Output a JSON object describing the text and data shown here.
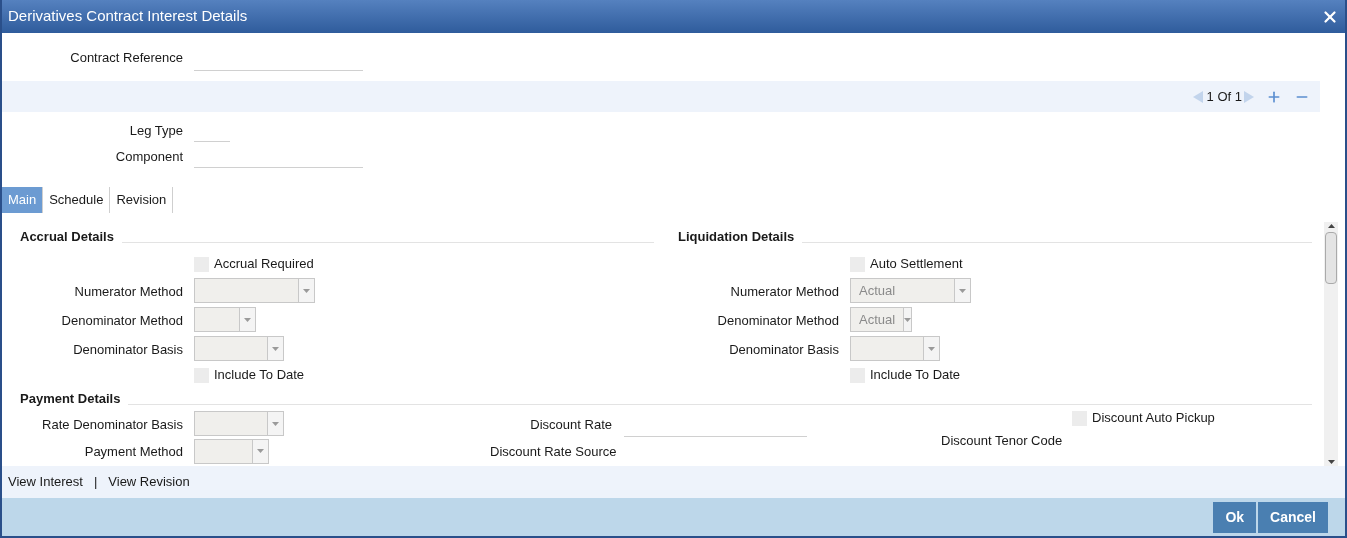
{
  "window": {
    "title": "Derivatives Contract Interest Details"
  },
  "contract_reference": {
    "label": "Contract Reference"
  },
  "pager": {
    "text": "1 Of 1"
  },
  "leg_fields": [
    {
      "label": "Leg Type",
      "kind": "short"
    },
    {
      "label": "Component",
      "kind": "long"
    }
  ],
  "tabs": [
    {
      "label": "Main",
      "selected": true
    },
    {
      "label": "Schedule",
      "selected": false
    },
    {
      "label": "Revision",
      "selected": false
    }
  ],
  "accrual_details": {
    "title": "Accrual Details",
    "rows": [
      {
        "kind": "checkbox",
        "label": "Accrual Required",
        "checked": false
      },
      {
        "kind": "select",
        "label": "Numerator Method",
        "disabled": true
      },
      {
        "kind": "select",
        "label": "Denominator Method",
        "disabled": true
      },
      {
        "kind": "select",
        "label": "Denominator Basis",
        "disabled": true
      },
      {
        "kind": "checkbox",
        "label": "Include To Date",
        "checked": false
      }
    ]
  },
  "liquidation_details": {
    "title": "Liquidation Details",
    "rows": [
      {
        "kind": "checkbox",
        "label": "Auto Settlement",
        "checked": false
      },
      {
        "kind": "select",
        "label": "Numerator Method",
        "value": "Actual",
        "disabled": true
      },
      {
        "kind": "select",
        "label": "Denominator Method",
        "value": "Actual",
        "disabled": true
      },
      {
        "kind": "select",
        "label": "Denominator Basis",
        "disabled": true
      },
      {
        "kind": "checkbox",
        "label": "Include To Date",
        "checked": false
      }
    ]
  },
  "payment_details": {
    "title": "Payment Details",
    "rate_denominator_basis": {
      "label": "Rate Denominator Basis",
      "disabled": true
    },
    "payment_method": {
      "label": "Payment Method",
      "disabled": true
    },
    "discount_rate": {
      "label": "Discount Rate"
    },
    "discount_rate_source": {
      "label": "Discount Rate Source"
    },
    "discount_auto_pickup": {
      "label": "Discount Auto Pickup",
      "checked": false
    },
    "discount_tenor_code": {
      "label": "Discount Tenor Code"
    }
  },
  "footer_links": [
    {
      "label": "View Interest"
    },
    {
      "label": "View Revision"
    }
  ],
  "link_separator": "|",
  "buttons": [
    {
      "label": "Ok"
    },
    {
      "label": "Cancel"
    }
  ]
}
